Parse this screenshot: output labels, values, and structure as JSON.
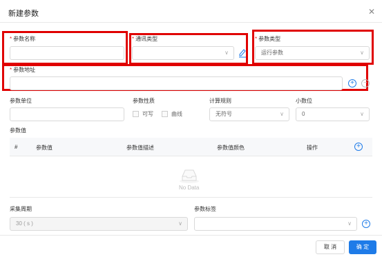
{
  "dialog": {
    "title": "新建参数",
    "close_icon": "close-icon"
  },
  "form": {
    "param_name": {
      "label": "参数名称",
      "value": ""
    },
    "comm_type": {
      "label": "通讯类型",
      "value": ""
    },
    "param_type": {
      "label": "参数类型",
      "value": "运行参数"
    },
    "param_address": {
      "label": "参数地址",
      "value": ""
    },
    "param_unit": {
      "label": "参数单位",
      "value": ""
    },
    "param_nature": {
      "label": "参数性质",
      "options": [
        "可写",
        "曲线"
      ]
    },
    "calc_rule": {
      "label": "计算规则",
      "value": "无符号"
    },
    "decimals": {
      "label": "小数位",
      "value": "0"
    },
    "param_value": {
      "label": "参数值",
      "columns": [
        "#",
        "参数值",
        "参数值描述",
        "参数值颜色",
        "操作"
      ],
      "empty_text": "No Data"
    },
    "collect_period": {
      "label": "采集周期",
      "value": "30 ( s )"
    },
    "param_tag": {
      "label": "参数标签",
      "value": ""
    }
  },
  "footer": {
    "cancel_label": "取 消",
    "ok_label": "确 定"
  },
  "colors": {
    "accent": "#1e7be8",
    "highlight": "#e00000",
    "required": "#e02020"
  }
}
